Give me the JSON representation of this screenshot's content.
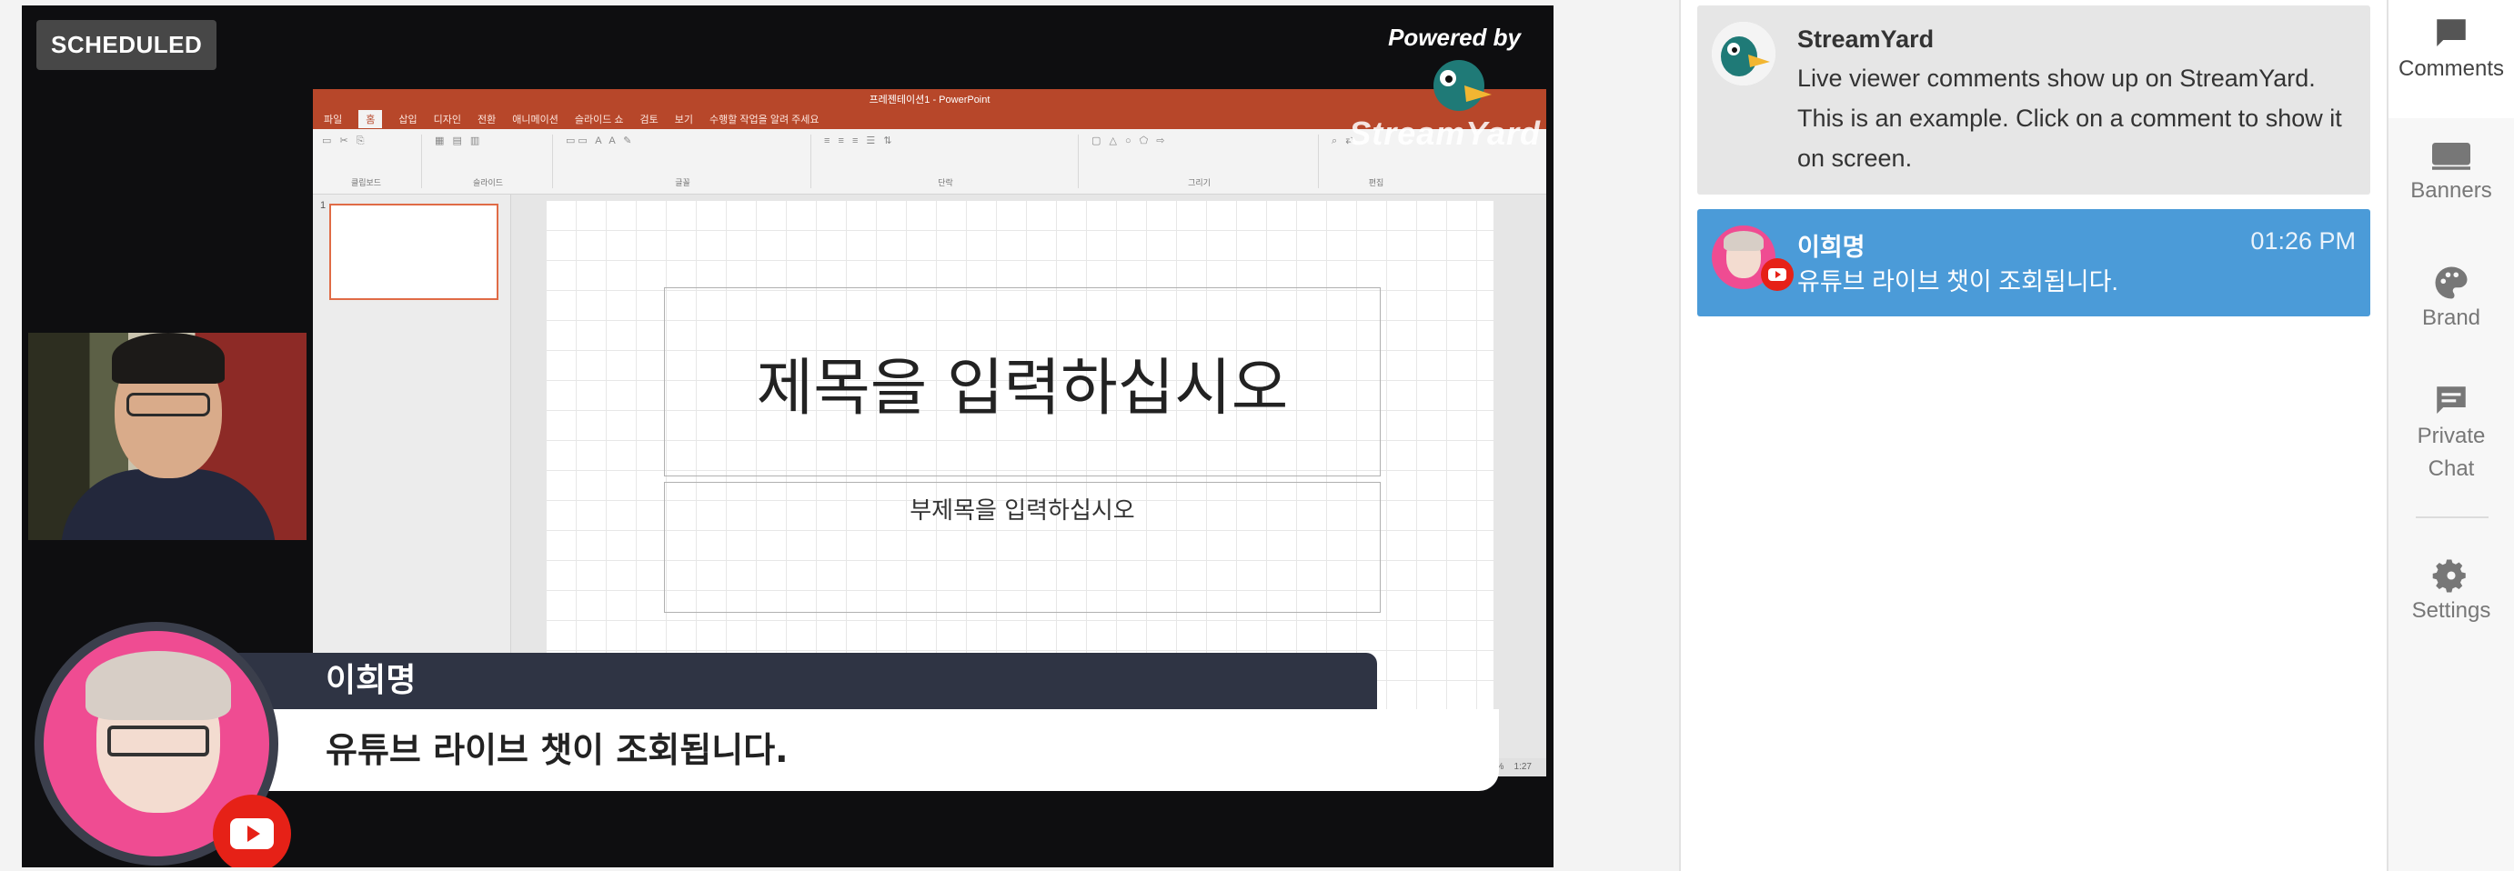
{
  "stage": {
    "badge": "SCHEDULED",
    "powered_by": "Powered by",
    "watermark": "StreamYard"
  },
  "ppt": {
    "window_title": "프레젠테이션1 - PowerPoint",
    "tabs": [
      "파일",
      "홈",
      "삽입",
      "디자인",
      "전환",
      "애니메이션",
      "슬라이드 쇼",
      "검토",
      "보기",
      "수행할 작업을 알려 주세요"
    ],
    "ribbon_groups": [
      "클립보드",
      "슬라이드",
      "글꼴",
      "단락",
      "그리기",
      "편집"
    ],
    "slide_number": "1",
    "title_placeholder": "제목을 입력하십시오",
    "subtitle_placeholder": "부제목을 입력하십시오",
    "zoom": "116 %",
    "clock": "1:27"
  },
  "overlay": {
    "name": "이희명",
    "message": "유튜브 라이브 챗이 조회됩니다."
  },
  "comments": [
    {
      "author": "StreamYard",
      "text_lines": [
        "Live viewer comments show up on StreamYard.",
        "This is an example. Click on a comment to show it",
        "on screen."
      ]
    },
    {
      "author": "이희명",
      "time": "01:26 PM",
      "text": "유튜브 라이브 챗이 조회됩니다."
    }
  ],
  "rail": {
    "comments": "Comments",
    "banners": "Banners",
    "brand": "Brand",
    "private_chat_line1": "Private",
    "private_chat_line2": "Chat",
    "settings": "Settings"
  },
  "colors": {
    "selected_comment": "#4b9bd8",
    "powerpoint_accent": "#b7472a",
    "youtube_red": "#e62117",
    "overlay_name_bar": "#2f3444"
  }
}
